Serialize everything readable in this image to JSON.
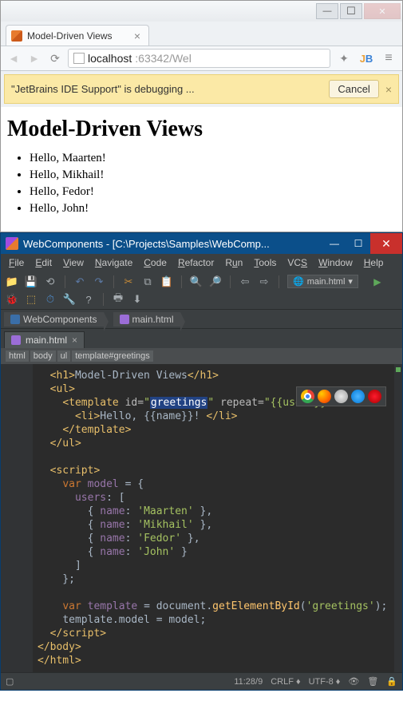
{
  "browser": {
    "tab_title": "Model-Driven Views",
    "url_host": "localhost",
    "url_port_path": ":63342/Wel",
    "debug_message": "\"JetBrains IDE Support\" is debugging ...",
    "debug_cancel": "Cancel",
    "page": {
      "h1": "Model-Driven Views",
      "items": [
        "Hello, Maarten!",
        "Hello, Mikhail!",
        "Hello, Fedor!",
        "Hello, John!"
      ]
    }
  },
  "ide": {
    "title": "WebComponents - [C:\\Projects\\Samples\\WebComp...",
    "menus": [
      "File",
      "Edit",
      "View",
      "Navigate",
      "Code",
      "Refactor",
      "Run",
      "Tools",
      "VCS",
      "Window",
      "Help"
    ],
    "run_config": "main.html",
    "breadcrumb_project": "WebComponents",
    "breadcrumb_file": "main.html",
    "editor_tab": "main.html",
    "dom_path": [
      "html",
      "body",
      "ul",
      "template#greetings"
    ],
    "code": {
      "h1_text": "Model-Driven Views",
      "template_id": "greetings",
      "repeat_expr": "{{users}}",
      "li_text": "Hello, {{name}}! ",
      "var_name": "model",
      "users_key": "users",
      "name_key": "name",
      "names": [
        "Maarten",
        "Mikhail",
        "Fedor",
        "John"
      ],
      "getById_arg": "greetings",
      "assign_lhs": "template.model",
      "assign_rhs": "model"
    },
    "status": {
      "pos": "11:28/9",
      "line_sep": "CRLF",
      "encoding": "UTF-8"
    }
  }
}
